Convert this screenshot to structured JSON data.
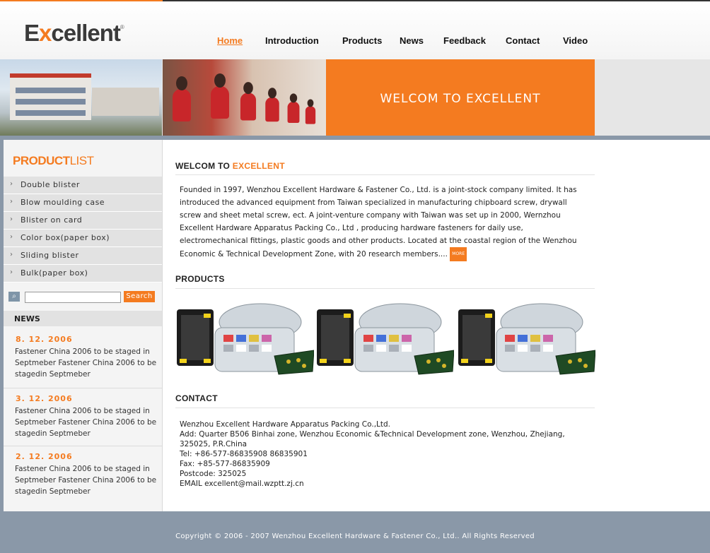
{
  "header": {
    "logo_text_pre": "E",
    "logo_text_x": "x",
    "logo_text_post": "cellent",
    "logo_mark": "®",
    "nav": [
      "Home",
      "Introduction",
      "Products",
      "News",
      "Feedback",
      "Contact",
      "Video"
    ],
    "active_nav": "Home"
  },
  "banner": {
    "welcome": "WELCOM TO EXCELLENT"
  },
  "sidebar": {
    "title_bold": "PRODUCT",
    "title_light": "LIST",
    "categories": [
      "Double blister",
      "Blow moulding case",
      "Blister on card",
      "Color box(paper box)",
      "Sliding blister",
      "Bulk(paper box)"
    ],
    "search": {
      "placeholder": "",
      "button": "Search"
    },
    "news_heading": "NEWS",
    "news": [
      {
        "date": "8. 12. 2006",
        "text": "Fastener China 2006 to be staged in Septmeber Fastener China 2006 to be stagedin Septmeber"
      },
      {
        "date": "3. 12. 2006",
        "text": "Fastener China 2006 to be staged in Septmeber Fastener China 2006 to be stagedin Septmeber"
      },
      {
        "date": "2. 12. 2006",
        "text": "Fastener China 2006 to be staged in Septmeber Fastener China 2006 to be stagedin Septmeber"
      }
    ]
  },
  "main": {
    "welcome_title_pre": "WELCOM TO",
    "welcome_title_accent": "EXCELLENT",
    "about": "Founded in 1997, Wenzhou Excellent Hardware & Fastener Co., Ltd. is a joint-stock company limited. It has introduced the advanced equipment from Taiwan specialized in manufacturing chipboard screw, drywall screw and sheet metal screw, ect. A joint-venture company with Taiwan was set up in 2000, Wernzhou Excellent Hardware Apparatus Packing Co., Ltd , producing hardware fasteners for daily use, electromechanical fittings, plastic goods and other products. Located at the coastal region of the Wenzhou Economic & Technical Development Zone, with 20 research members....",
    "more_label": "MORE",
    "products_title": "PRODUCTS",
    "contact_title": "CONTACT",
    "contact_lines": [
      "Wenzhou Excellent Hardware Apparatus Packing Co.,Ltd.",
      "Add: Quarter B506 Binhai zone, Wenzhou Economic &Technical Development zone, Wenzhou, Zhejiang,",
      "325025, P.R.China",
      "Tel: +86-577-86835908 86835901",
      "Fax: +85-577-86835909",
      "Postcode: 325025",
      "EMAIL excellent@mail.wzptt.zj.cn"
    ]
  },
  "footer": {
    "copyright": "Copyright © 2006 - 2007 Wenzhou Excellent Hardware & Fastener Co., Ltd.. All Rights Reserved"
  },
  "colors": {
    "accent": "#f47b20",
    "frame": "#8a98a8"
  }
}
